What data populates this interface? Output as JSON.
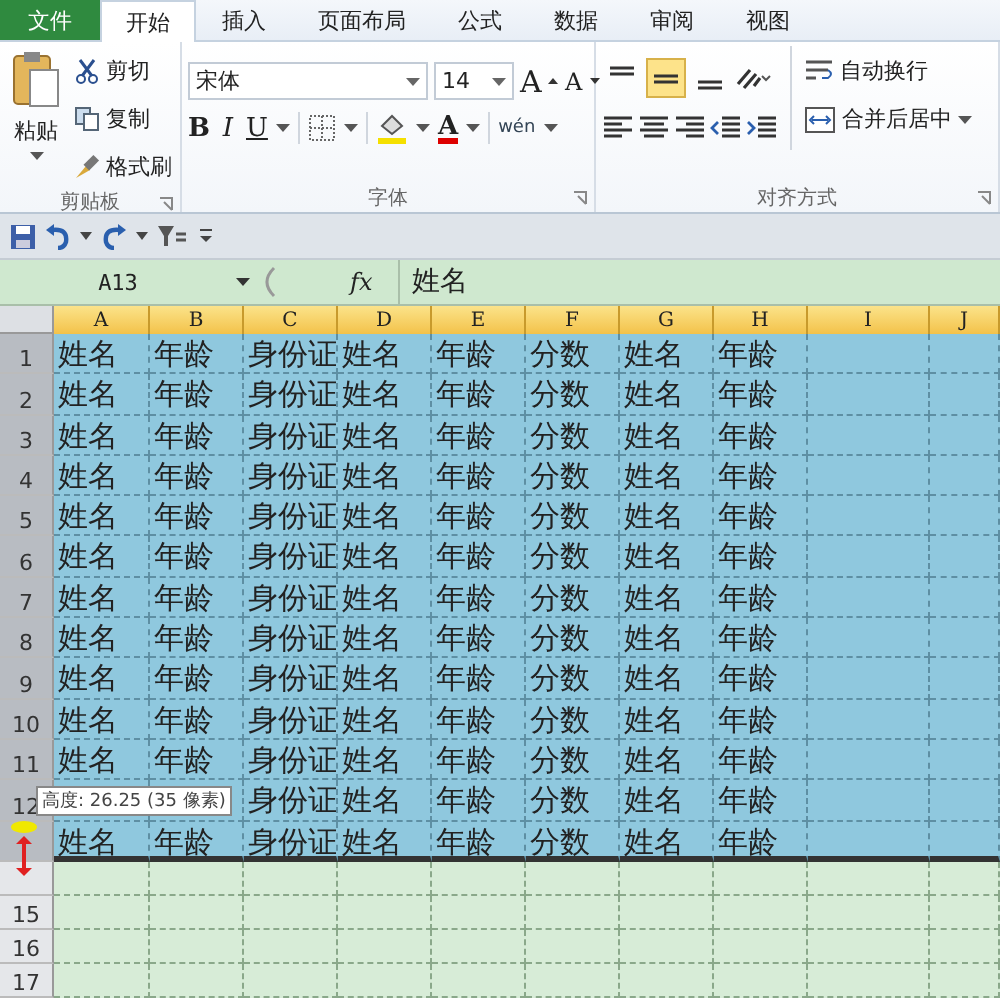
{
  "tabs": [
    {
      "label": "文件",
      "kind": "file",
      "selected": false
    },
    {
      "label": "开始",
      "kind": "tab",
      "selected": true
    },
    {
      "label": "插入",
      "kind": "tab",
      "selected": false
    },
    {
      "label": "页面布局",
      "kind": "tab",
      "selected": false
    },
    {
      "label": "公式",
      "kind": "tab",
      "selected": false
    },
    {
      "label": "数据",
      "kind": "tab",
      "selected": false
    },
    {
      "label": "审阅",
      "kind": "tab",
      "selected": false
    },
    {
      "label": "视图",
      "kind": "tab",
      "selected": false
    }
  ],
  "clipboard": {
    "paste": "粘贴",
    "items": [
      "剪切",
      "复制",
      "格式刷"
    ],
    "label": "剪贴板"
  },
  "font": {
    "name": "宋体",
    "size": "14",
    "grow": "A",
    "shrink": "A",
    "bold": "B",
    "italic": "I",
    "underline": "U",
    "color_letter": "A",
    "phonetic": "wén",
    "label": "字体"
  },
  "alignment": {
    "vertical": [
      {
        "selected": false
      },
      {
        "selected": true
      },
      {
        "selected": false
      }
    ],
    "wrap": "自动换行",
    "merge": "合并后居中",
    "label": "对齐方式"
  },
  "formula_bar": {
    "name_box": "A13",
    "fx": "fx",
    "content": "姓名"
  },
  "columns": [
    "A",
    "B",
    "C",
    "D",
    "E",
    "F",
    "G",
    "H",
    "I",
    "J"
  ],
  "rows": [
    {
      "num": "1",
      "selected": true,
      "cells": [
        "姓名",
        "年龄",
        "身份证",
        "姓名",
        "年龄",
        "分数",
        "姓名",
        "年龄"
      ]
    },
    {
      "num": "2",
      "selected": true,
      "cells": [
        "姓名",
        "年龄",
        "身份证",
        "姓名",
        "年龄",
        "分数",
        "姓名",
        "年龄"
      ]
    },
    {
      "num": "3",
      "selected": true,
      "cells": [
        "姓名",
        "年龄",
        "身份证",
        "姓名",
        "年龄",
        "分数",
        "姓名",
        "年龄"
      ]
    },
    {
      "num": "4",
      "selected": true,
      "cells": [
        "姓名",
        "年龄",
        "身份证",
        "姓名",
        "年龄",
        "分数",
        "姓名",
        "年龄"
      ]
    },
    {
      "num": "5",
      "selected": true,
      "cells": [
        "姓名",
        "年龄",
        "身份证",
        "姓名",
        "年龄",
        "分数",
        "姓名",
        "年龄"
      ]
    },
    {
      "num": "6",
      "selected": true,
      "cells": [
        "姓名",
        "年龄",
        "身份证",
        "姓名",
        "年龄",
        "分数",
        "姓名",
        "年龄"
      ]
    },
    {
      "num": "7",
      "selected": true,
      "cells": [
        "姓名",
        "年龄",
        "身份证",
        "姓名",
        "年龄",
        "分数",
        "姓名",
        "年龄"
      ]
    },
    {
      "num": "8",
      "selected": true,
      "cells": [
        "姓名",
        "年龄",
        "身份证",
        "姓名",
        "年龄",
        "分数",
        "姓名",
        "年龄"
      ]
    },
    {
      "num": "9",
      "selected": true,
      "cells": [
        "姓名",
        "年龄",
        "身份证",
        "姓名",
        "年龄",
        "分数",
        "姓名",
        "年龄"
      ]
    },
    {
      "num": "10",
      "selected": true,
      "cells": [
        "姓名",
        "年龄",
        "身份证",
        "姓名",
        "年龄",
        "分数",
        "姓名",
        "年龄"
      ]
    },
    {
      "num": "11",
      "selected": true,
      "cells": [
        "姓名",
        "年龄",
        "身份证",
        "姓名",
        "年龄",
        "分数",
        "姓名",
        "年龄"
      ]
    },
    {
      "num": "12",
      "selected": true,
      "cells": [
        "",
        "",
        "身份证",
        "姓名",
        "年龄",
        "分数",
        "姓名",
        "年龄"
      ]
    },
    {
      "num": "",
      "selected": true,
      "cells": [
        "姓名",
        "年龄",
        "身份证",
        "姓名",
        "年龄",
        "分数",
        "姓名",
        "年龄"
      ]
    },
    {
      "num": "",
      "selected": false,
      "cells": []
    },
    {
      "num": "15",
      "selected": false,
      "cells": []
    },
    {
      "num": "16",
      "selected": false,
      "cells": []
    },
    {
      "num": "17",
      "selected": false,
      "cells": []
    }
  ],
  "tooltip": "高度: 26.25 (35 像素)"
}
